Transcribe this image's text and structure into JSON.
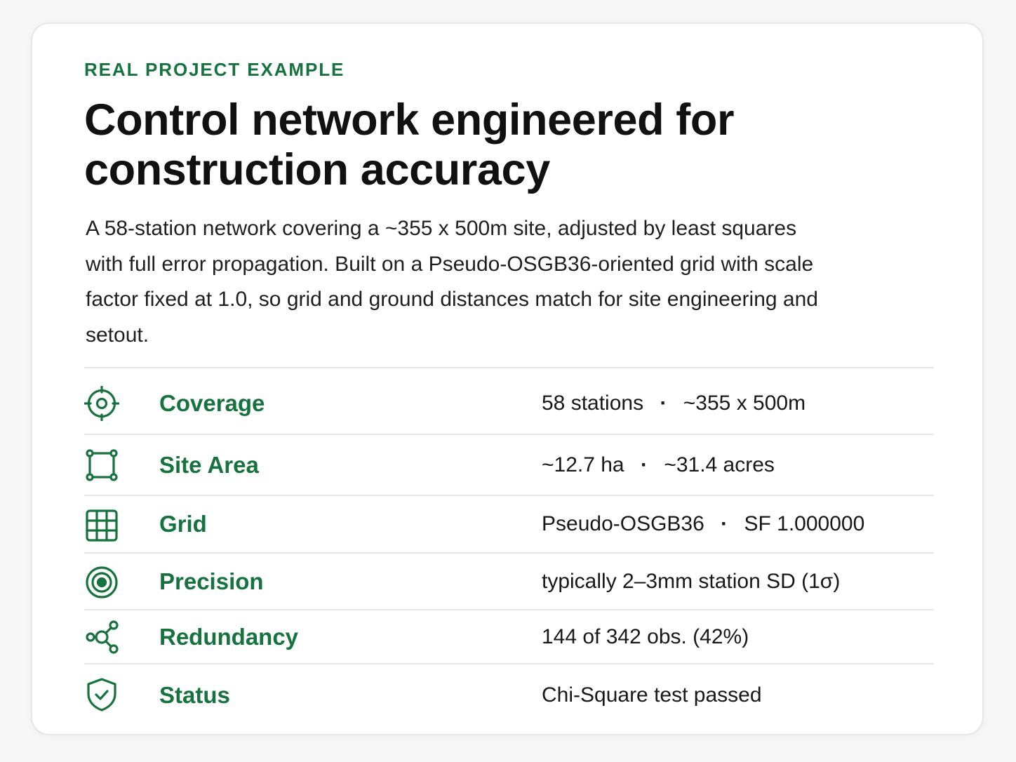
{
  "card": {
    "eyebrow": "REAL PROJECT EXAMPLE",
    "title": "Control network engineered for construction accuracy",
    "description": "A 58-station network covering a ~355 x 500m site, adjusted by least squares with full error propagation. Built on a Pseudo-OSGB36-oriented grid with scale factor fixed at 1.0, so grid and ground distances match for site engineering and setout."
  },
  "details": {
    "separator": "·",
    "rows": [
      {
        "icon": "target-crosshair-icon",
        "label": "Coverage",
        "value_a": "58 stations",
        "value_b": "~355 x 500m"
      },
      {
        "icon": "area-bounding-box-icon",
        "label": "Site Area",
        "value_a": "~12.7 ha",
        "value_b": "~31.4 acres"
      },
      {
        "icon": "grid-icon",
        "label": "Grid",
        "value_a": "Pseudo-OSGB36",
        "value_b": "SF 1.000000"
      },
      {
        "icon": "concentric-target-icon",
        "label": "Precision",
        "value": "typically 2–3mm station SD (1σ)"
      },
      {
        "icon": "network-nodes-icon",
        "label": "Redundancy",
        "value": "144 of 342 obs. (42%)"
      },
      {
        "icon": "shield-check-icon",
        "label": "Status",
        "value": "Chi-Square test passed"
      }
    ]
  },
  "colors": {
    "accent": "#17733d",
    "text": "#111111",
    "background": "#f6f6f6",
    "card": "#ffffff",
    "divider": "#e6e6e6"
  }
}
